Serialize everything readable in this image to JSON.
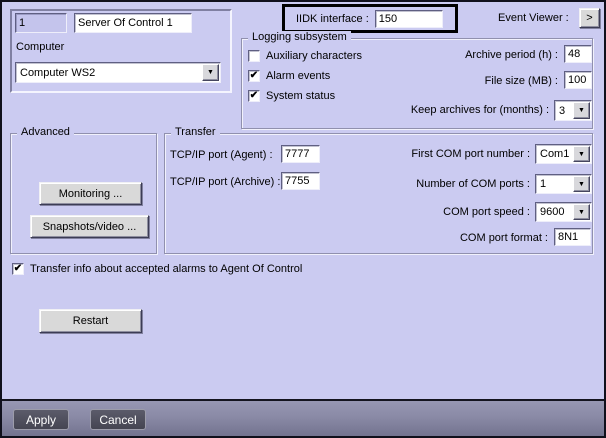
{
  "colors": {
    "dialog_bg": "#cbcbf1",
    "field_lavender": "#c4c4ec",
    "button_face": "#d9d9d9",
    "footer_top": "#9797b3",
    "footer_bottom": "#73738f",
    "dark_button": "#4e4e5d",
    "highlight_border": "#000000"
  },
  "icons": {
    "dropdown_arrow": "▼",
    "check_mark": "✔",
    "event_viewer_arrow": ">"
  },
  "header": {
    "id_value": "1",
    "server_name": "Server Of Control 1",
    "computer_label": "Computer",
    "computer_value": "Computer WS2",
    "iidk_label": "IIDK interface :",
    "iidk_value": "150",
    "event_viewer_label": "Event Viewer :"
  },
  "logging": {
    "title": "Logging subsystem",
    "checkboxes": [
      {
        "label": "Auxiliary characters",
        "mark": ""
      },
      {
        "label": "Alarm events",
        "mark": "✔"
      },
      {
        "label": "System status",
        "mark": "✔"
      }
    ],
    "archive_label": "Archive period (h) :",
    "archive_value": "48",
    "filesize_label": "File size (MB) :",
    "filesize_value": "100",
    "keep_label": "Keep archives for (months) :",
    "keep_value": "3"
  },
  "advanced": {
    "title": "Advanced",
    "monitoring_button": "Monitoring ...",
    "snapshots_button": "Snapshots/video ..."
  },
  "transfer": {
    "title": "Transfer",
    "tcp_agent_label": "TCP/IP port (Agent) :",
    "tcp_agent_value": "7777",
    "tcp_archive_label": "TCP/IP port (Archive) :",
    "tcp_archive_value": "7755",
    "first_com_label": "First COM port number :",
    "first_com_value": "Com1",
    "num_com_label": "Number of COM ports :",
    "num_com_value": "1",
    "com_speed_label": "COM port speed :",
    "com_speed_value": "9600",
    "com_format_label": "COM port format :",
    "com_format_value": "8N1"
  },
  "bottom": {
    "transfer_info_label": "Transfer info about accepted alarms to Agent Of Control",
    "transfer_info_mark": "✔",
    "restart_button": "Restart",
    "apply_button": "Apply",
    "cancel_button": "Cancel"
  }
}
